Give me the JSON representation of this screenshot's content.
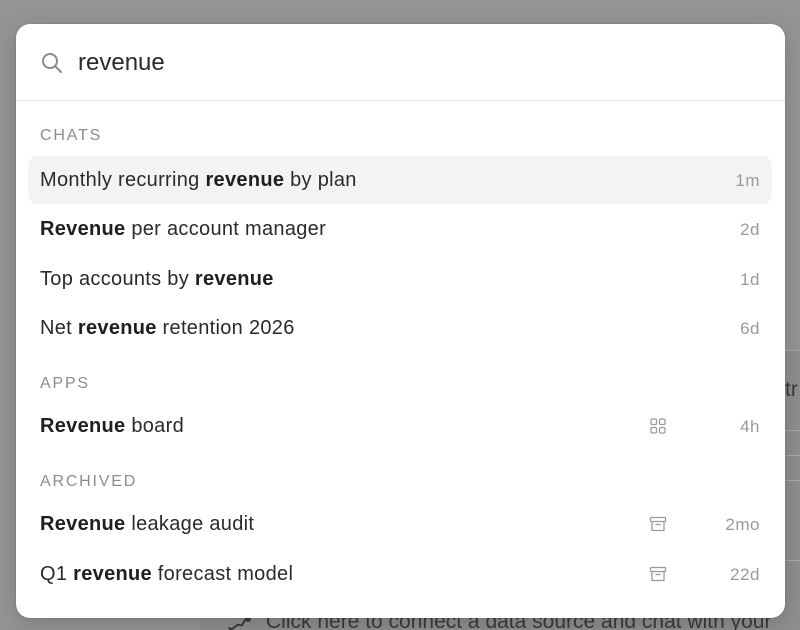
{
  "search": {
    "value": "revenue",
    "placeholder": ""
  },
  "sections": {
    "chats": {
      "label": "CHATS"
    },
    "apps": {
      "label": "APPS"
    },
    "archived": {
      "label": "ARCHIVED"
    }
  },
  "chats": [
    {
      "before": "Monthly recurring ",
      "match": "revenue",
      "after": " by plan",
      "time": "1m",
      "selected": true
    },
    {
      "before": "",
      "match": "Revenue",
      "after": " per account manager",
      "time": "2d"
    },
    {
      "before": "Top accounts by ",
      "match": "revenue",
      "after": "",
      "time": "1d"
    },
    {
      "before": "Net ",
      "match": "revenue",
      "after": " retention 2026",
      "time": "6d"
    }
  ],
  "apps": [
    {
      "before": "",
      "match": "Revenue",
      "after": " board",
      "time": "4h",
      "icon": "grid-icon"
    }
  ],
  "archived": [
    {
      "before": "",
      "match": "Revenue",
      "after": " leakage audit",
      "time": "2mo",
      "icon": "archive-box-icon"
    },
    {
      "before": "Q1 ",
      "match": "revenue",
      "after": " forecast model",
      "time": "22d",
      "icon": "archive-box-icon"
    }
  ],
  "background": {
    "fragment": "tr",
    "hint": "Click here to connect a data source and chat with your"
  },
  "colors": {
    "overlay": "#959595",
    "selected_row": "#f4f3f1",
    "muted_text": "#9a9a9a",
    "section_label": "#8c8c8c"
  }
}
